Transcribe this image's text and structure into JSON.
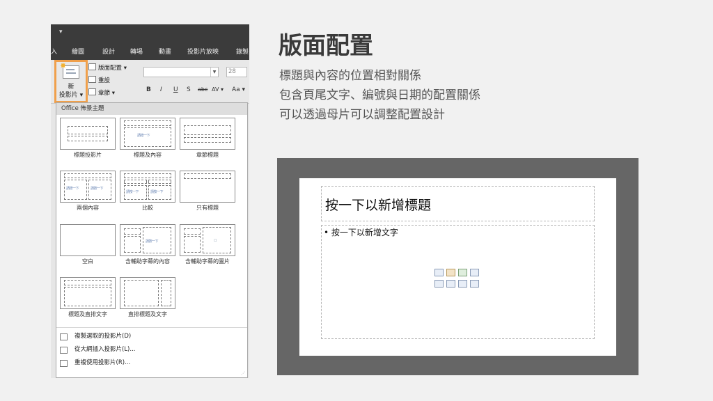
{
  "ribbon": {
    "quick_access_glyph": "▾",
    "tabs": [
      "入",
      "繪圖",
      "設計",
      "轉場",
      "動畫",
      "投影片放映",
      "錄製"
    ],
    "new_slide_label_1": "新",
    "new_slide_label_2": "投影片 ▾",
    "layout_button": "版面配置 ▾",
    "reset_button": "重設",
    "section_button": "章節 ▾",
    "font_size": "28",
    "format_buttons": [
      "B",
      "I",
      "U",
      "S",
      "abc",
      "AV ▾",
      "Aa ▾"
    ]
  },
  "gallery": {
    "header": "Office 佈景主題",
    "layouts": [
      "標題投影片",
      "標題及內容",
      "章節標題",
      "兩個內容",
      "比較",
      "只有標題",
      "空白",
      "含輔助字幕的內容",
      "含輔助字幕的圖片",
      "標題及直排文字",
      "直排標題及文字"
    ],
    "menu": [
      "複製選取的投影片(D)",
      "從大綱插入投影片(L)...",
      "重複使用投影片(R)..."
    ],
    "mini_text": "請按一下"
  },
  "heading": {
    "title": "版面配置",
    "lines": [
      "標題與內容的位置相對關係",
      "包含頁尾文字、編號與日期的配置關係",
      "可以透過母片可以調整配置設計"
    ]
  },
  "preview": {
    "title_placeholder": "按一下以新增標題",
    "content_placeholder": "• 按一下以新增文字"
  },
  "colors": {
    "accent_highlight": "#f0a04b",
    "ribbon_dark": "#3b3b3b",
    "preview_frame": "#666666"
  }
}
